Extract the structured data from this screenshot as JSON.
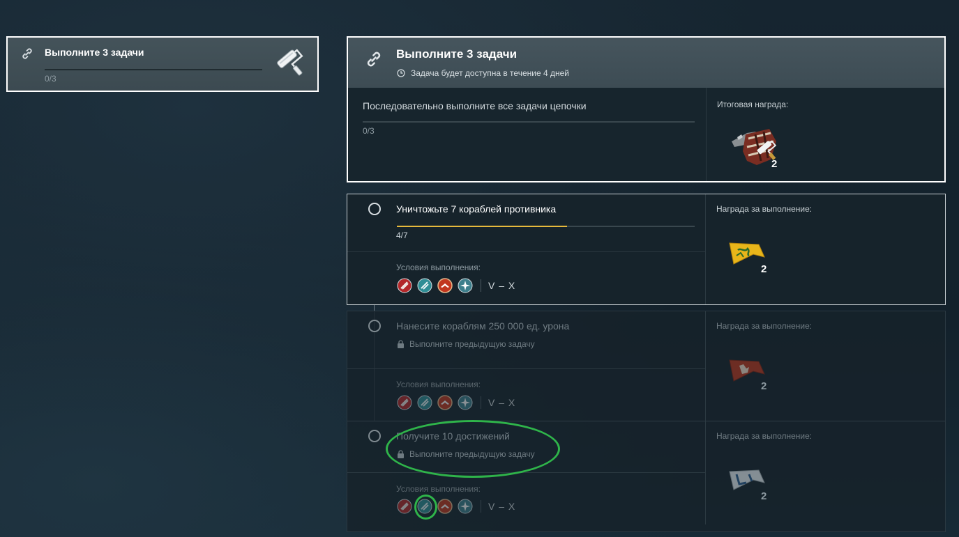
{
  "mini_card": {
    "title": "Выполните 3 задачи",
    "progress": "0/3",
    "progress_fraction": 0,
    "link_icon": "chain-link-icon",
    "reward_icon": "paint-roller-icon"
  },
  "main_card": {
    "title": "Выполните 3 задачи",
    "availability": "Задача будет доступна в течение 4 дней",
    "description": "Последовательно выполните все задачи цепочки",
    "progress": "0/3",
    "progress_fraction": 0,
    "reward_label": "Итоговая награда:",
    "reward_count": "2",
    "reward_icon": "camouflage-roller-icon"
  },
  "tasks": [
    {
      "title": "Уничтожьте 7 кораблей противника",
      "progress": "4/7",
      "progress_fraction": 0.571,
      "conditions_label": "Условия выполнения:",
      "tiers": "V – X",
      "reward_label": "Награда за выполнение:",
      "reward_count": "2",
      "reward_icon": "yellow-signal-flag-icon",
      "status": "active"
    },
    {
      "title": "Нанесите кораблям 250 000 ед. урона",
      "lock_text": "Выполните предыдущую задачу",
      "conditions_label": "Условия выполнения:",
      "tiers": "V – X",
      "reward_label": "Награда за выполнение:",
      "reward_count": "2",
      "reward_icon": "red-signal-flag-icon",
      "status": "locked"
    },
    {
      "title": "Получите 10 достижений",
      "lock_text": "Выполните предыдущую задачу",
      "conditions_label": "Условия выполнения:",
      "tiers": "V – X",
      "reward_label": "Награда за выполнение:",
      "reward_count": "2",
      "reward_icon": "blue-signal-flag-icon",
      "status": "locked"
    }
  ],
  "condition_icons": [
    "battleship-class-icon",
    "cruiser-class-icon",
    "destroyer-class-icon",
    "aircraft-carrier-class-icon"
  ],
  "colors": {
    "progress_accent": "#e6b93c",
    "annotation": "#2fb44a",
    "card_border": "#ffffff"
  }
}
